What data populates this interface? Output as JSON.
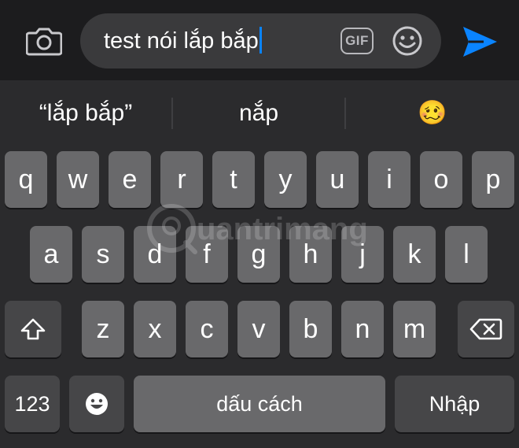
{
  "composer": {
    "text": "test nói lắp bắp",
    "gif_label": "GIF",
    "icons": {
      "camera": "camera-icon",
      "sticker": "smiley-icon",
      "send": "paper-plane-icon"
    },
    "accent_color": "#0a84ff"
  },
  "suggestions": [
    "“lắp bắp”",
    "nắp",
    "🥴"
  ],
  "keyboard": {
    "row1": [
      "q",
      "w",
      "e",
      "r",
      "t",
      "y",
      "u",
      "i",
      "o",
      "p"
    ],
    "row2": [
      "a",
      "s",
      "d",
      "f",
      "g",
      "h",
      "j",
      "k",
      "l"
    ],
    "row3": [
      "z",
      "x",
      "c",
      "v",
      "b",
      "n",
      "m"
    ],
    "numbers_label": "123",
    "space_label": "dấu cách",
    "return_label": "Nhập",
    "icons": {
      "shift": "shift-icon",
      "backspace": "backspace-icon",
      "emoji": "emoji-icon"
    }
  },
  "watermark": {
    "text": "uantrimang",
    "icon": "quantrimang-logo"
  }
}
